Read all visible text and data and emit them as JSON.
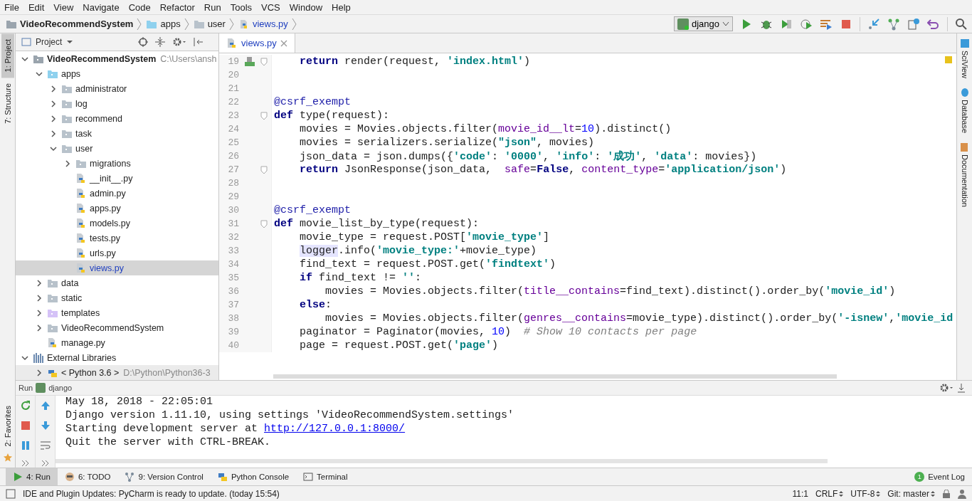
{
  "menu": [
    "File",
    "Edit",
    "View",
    "Navigate",
    "Code",
    "Refactor",
    "Run",
    "Tools",
    "VCS",
    "Window",
    "Help"
  ],
  "breadcrumb": [
    {
      "label": "VideoRecommendSystem",
      "kind": "project"
    },
    {
      "label": "apps",
      "kind": "source-folder"
    },
    {
      "label": "user",
      "kind": "folder"
    },
    {
      "label": "views.py",
      "kind": "python-file"
    }
  ],
  "run_config": "django",
  "left_tabs_top": [
    {
      "label": "1: Project",
      "selected": true
    },
    {
      "label": "7: Structure",
      "selected": false
    }
  ],
  "left_tabs_bottom": [
    {
      "label": "2: Favorites",
      "selected": false
    }
  ],
  "right_tabs": [
    {
      "label": "SciView",
      "kind": "sciview"
    },
    {
      "label": "Database",
      "kind": "database"
    },
    {
      "label": "Documentation",
      "kind": "doc"
    }
  ],
  "project": {
    "title": "Project",
    "tree": [
      {
        "name": "VideoRecommendSystem",
        "kind": "project",
        "hint": "C:\\Users\\ansh",
        "expanded": true,
        "selected": false,
        "children": [
          {
            "name": "apps",
            "kind": "source-folder",
            "expanded": true,
            "selected": false,
            "children": [
              {
                "name": "administrator",
                "kind": "folder",
                "expanded": false,
                "selected": false
              },
              {
                "name": "log",
                "kind": "folder",
                "expanded": false,
                "selected": false
              },
              {
                "name": "recommend",
                "kind": "folder",
                "expanded": false,
                "selected": false
              },
              {
                "name": "task",
                "kind": "folder",
                "expanded": false,
                "selected": false
              },
              {
                "name": "user",
                "kind": "folder",
                "expanded": true,
                "selected": false,
                "children": [
                  {
                    "name": "migrations",
                    "kind": "folder",
                    "expanded": false,
                    "selected": false
                  },
                  {
                    "name": "__init__.py",
                    "kind": "python-file",
                    "selected": false
                  },
                  {
                    "name": "admin.py",
                    "kind": "python-file",
                    "selected": false
                  },
                  {
                    "name": "apps.py",
                    "kind": "python-file",
                    "selected": false
                  },
                  {
                    "name": "models.py",
                    "kind": "python-file",
                    "selected": false
                  },
                  {
                    "name": "tests.py",
                    "kind": "python-file",
                    "selected": false
                  },
                  {
                    "name": "urls.py",
                    "kind": "python-file",
                    "selected": false
                  },
                  {
                    "name": "views.py",
                    "kind": "python-file",
                    "selected": true
                  }
                ]
              }
            ]
          },
          {
            "name": "data",
            "kind": "folder",
            "expanded": false,
            "selected": false
          },
          {
            "name": "static",
            "kind": "folder",
            "expanded": false,
            "selected": false
          },
          {
            "name": "templates",
            "kind": "template-folder",
            "expanded": false,
            "selected": false
          },
          {
            "name": "VideoRecommendSystem",
            "kind": "folder",
            "expanded": false,
            "selected": false
          },
          {
            "name": "manage.py",
            "kind": "python-file",
            "selected": false
          }
        ]
      },
      {
        "name": "External Libraries",
        "kind": "library",
        "expanded": true,
        "selected": false,
        "children": [
          {
            "name": "< Python 3.6 >",
            "kind": "sdk",
            "hint": "D:\\Python\\Python36-3",
            "expanded": false,
            "selected": false
          }
        ]
      }
    ]
  },
  "editor": {
    "tab": "views.py",
    "lines": [
      {
        "number": "19",
        "fold": true,
        "gutter_mark": true,
        "tokens": [
          {
            "text": "    return",
            "kind": "keyword"
          },
          {
            "text": " render(request, "
          },
          {
            "text": "'index.html'",
            "kind": "string"
          },
          {
            "text": ")"
          }
        ]
      },
      {
        "number": "20",
        "fold": false,
        "gutter_mark": false
      },
      {
        "number": "21",
        "fold": false,
        "gutter_mark": false
      },
      {
        "number": "22",
        "fold": false,
        "gutter_mark": false,
        "tokens": [
          {
            "text": "@csrf_exempt",
            "kind": "decorator"
          }
        ]
      },
      {
        "number": "23",
        "fold": true,
        "gutter_mark": false,
        "tokens": [
          {
            "text": "def",
            "kind": "keyword"
          },
          {
            "text": " type(request):"
          }
        ]
      },
      {
        "number": "24",
        "fold": false,
        "gutter_mark": false,
        "tokens": [
          {
            "text": "    movies = Movies.objects.filter("
          },
          {
            "text": "movie_id__lt",
            "kind": "param"
          },
          {
            "text": "="
          },
          {
            "text": "10",
            "kind": "number"
          },
          {
            "text": ").distinct()"
          }
        ]
      },
      {
        "number": "25",
        "fold": false,
        "gutter_mark": false,
        "tokens": [
          {
            "text": "    movies = serializers.serialize("
          },
          {
            "text": "\"json\"",
            "kind": "string"
          },
          {
            "text": ", movies)"
          }
        ]
      },
      {
        "number": "26",
        "fold": false,
        "gutter_mark": false,
        "tokens": [
          {
            "text": "    json_data = json.dumps({"
          },
          {
            "text": "'code'",
            "kind": "string"
          },
          {
            "text": ": "
          },
          {
            "text": "'0000'",
            "kind": "string"
          },
          {
            "text": ", "
          },
          {
            "text": "'info'",
            "kind": "string"
          },
          {
            "text": ": "
          },
          {
            "text": "'成功'",
            "kind": "string"
          },
          {
            "text": ", "
          },
          {
            "text": "'data'",
            "kind": "string"
          },
          {
            "text": ": movies})"
          }
        ]
      },
      {
        "number": "27",
        "fold": true,
        "gutter_mark": false,
        "tokens": [
          {
            "text": "    return",
            "kind": "keyword"
          },
          {
            "text": " JsonResponse(json_data,  "
          },
          {
            "text": "safe",
            "kind": "param"
          },
          {
            "text": "="
          },
          {
            "text": "False",
            "kind": "keyword"
          },
          {
            "text": ", "
          },
          {
            "text": "content_type",
            "kind": "param"
          },
          {
            "text": "="
          },
          {
            "text": "'application/json'",
            "kind": "string"
          },
          {
            "text": ")"
          }
        ]
      },
      {
        "number": "28",
        "fold": false,
        "gutter_mark": false
      },
      {
        "number": "29",
        "fold": false,
        "gutter_mark": false
      },
      {
        "number": "30",
        "fold": false,
        "gutter_mark": false,
        "tokens": [
          {
            "text": "@csrf_exempt",
            "kind": "decorator"
          }
        ]
      },
      {
        "number": "31",
        "fold": true,
        "gutter_mark": false,
        "tokens": [
          {
            "text": "def",
            "kind": "keyword"
          },
          {
            "text": " movie_list_by_type(request):"
          }
        ]
      },
      {
        "number": "32",
        "fold": false,
        "gutter_mark": false,
        "tokens": [
          {
            "text": "    movie_type = request.POST["
          },
          {
            "text": "'movie_type'",
            "kind": "string"
          },
          {
            "text": "]"
          }
        ]
      },
      {
        "number": "33",
        "fold": false,
        "gutter_mark": false,
        "tokens": [
          {
            "text": "    logger",
            "kind": "highlight"
          },
          {
            "text": ".info("
          },
          {
            "text": "'movie_type:'",
            "kind": "string"
          },
          {
            "text": "+movie_type)"
          }
        ]
      },
      {
        "number": "34",
        "fold": false,
        "gutter_mark": false,
        "tokens": [
          {
            "text": "    find_text = request.POST.get("
          },
          {
            "text": "'findtext'",
            "kind": "string"
          },
          {
            "text": ")"
          }
        ]
      },
      {
        "number": "35",
        "fold": false,
        "gutter_mark": false,
        "tokens": [
          {
            "text": "    if",
            "kind": "keyword"
          },
          {
            "text": " find_text != "
          },
          {
            "text": "''",
            "kind": "string"
          },
          {
            "text": ":"
          }
        ]
      },
      {
        "number": "36",
        "fold": false,
        "gutter_mark": false,
        "tokens": [
          {
            "text": "        movies = Movies.objects.filter("
          },
          {
            "text": "title__contains",
            "kind": "param"
          },
          {
            "text": "=find_text).distinct().order_by("
          },
          {
            "text": "'movie_id'",
            "kind": "string"
          },
          {
            "text": ")"
          }
        ]
      },
      {
        "number": "37",
        "fold": false,
        "gutter_mark": false,
        "tokens": [
          {
            "text": "    else",
            "kind": "keyword"
          },
          {
            "text": ":"
          }
        ]
      },
      {
        "number": "38",
        "fold": false,
        "gutter_mark": false,
        "tokens": [
          {
            "text": "        movies = Movies.objects.filter("
          },
          {
            "text": "genres__contains",
            "kind": "param"
          },
          {
            "text": "=movie_type).distinct().order_by("
          },
          {
            "text": "'-isnew'",
            "kind": "string"
          },
          {
            "text": ","
          },
          {
            "text": "'movie_id",
            "kind": "string"
          }
        ]
      },
      {
        "number": "39",
        "fold": false,
        "gutter_mark": false,
        "tokens": [
          {
            "text": "    paginator = Paginator(movies, "
          },
          {
            "text": "10",
            "kind": "number"
          },
          {
            "text": ")  "
          },
          {
            "text": "# Show 10 contacts per page",
            "kind": "comment"
          }
        ]
      },
      {
        "number": "40",
        "fold": false,
        "gutter_mark": false,
        "tokens": [
          {
            "text": "    page = request.POST.get("
          },
          {
            "text": "'page'",
            "kind": "string"
          },
          {
            "text": ")"
          }
        ]
      }
    ]
  },
  "run_panel": {
    "label": "Run",
    "config": "django",
    "console": [
      {
        "text": "May 18, 2018 - 22:05:01"
      },
      {
        "text": "Django version 1.11.10, using settings 'VideoRecommendSystem.settings'"
      },
      {
        "text": "Starting development server at ",
        "link": "http://127.0.0.1:8000/"
      },
      {
        "text": "Quit the server with CTRL-BREAK."
      }
    ]
  },
  "tool_tabs": [
    {
      "label": "4: Run",
      "kind": "run",
      "selected": true
    },
    {
      "label": "6: TODO",
      "kind": "todo",
      "selected": false
    },
    {
      "label": "9: Version Control",
      "kind": "vcs",
      "selected": false
    },
    {
      "label": "Python Console",
      "kind": "python",
      "selected": false
    },
    {
      "label": "Terminal",
      "kind": "terminal",
      "selected": false
    }
  ],
  "event_log": {
    "label": "Event Log",
    "count": "1"
  },
  "status_bar": {
    "message": "IDE and Plugin Updates: PyCharm is ready to update. (today 15:54)",
    "position": "11:1",
    "line_separator": "CRLF",
    "encoding": "UTF-8",
    "vcs": "Git: master"
  }
}
